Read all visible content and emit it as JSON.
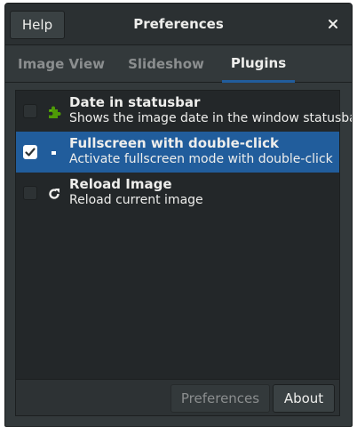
{
  "window": {
    "title": "Preferences",
    "help_label": "Help",
    "close_glyph": "✕"
  },
  "tabs": [
    {
      "label": "Image View",
      "active": false
    },
    {
      "label": "Slideshow",
      "active": false
    },
    {
      "label": "Plugins",
      "active": true
    }
  ],
  "plugins": [
    {
      "title": "Date in statusbar",
      "description": "Shows the image date in the window statusbar",
      "enabled": false,
      "selected": false,
      "icon": "puzzle-piece-icon"
    },
    {
      "title": "Fullscreen with double-click",
      "description": "Activate fullscreen mode with double-click",
      "enabled": true,
      "selected": true,
      "icon": "fullscreen-icon"
    },
    {
      "title": "Reload Image",
      "description": "Reload current image",
      "enabled": false,
      "selected": false,
      "icon": "reload-icon"
    }
  ],
  "toolbar": {
    "preferences_label": "Preferences",
    "preferences_enabled": false,
    "about_label": "About"
  },
  "colors": {
    "window_bg": "#33393b",
    "list_bg": "#232729",
    "selection": "#215d9c",
    "text": "#eeeeec",
    "text_dim": "#8b8e8f",
    "plugin_green": "#4e9a06"
  }
}
